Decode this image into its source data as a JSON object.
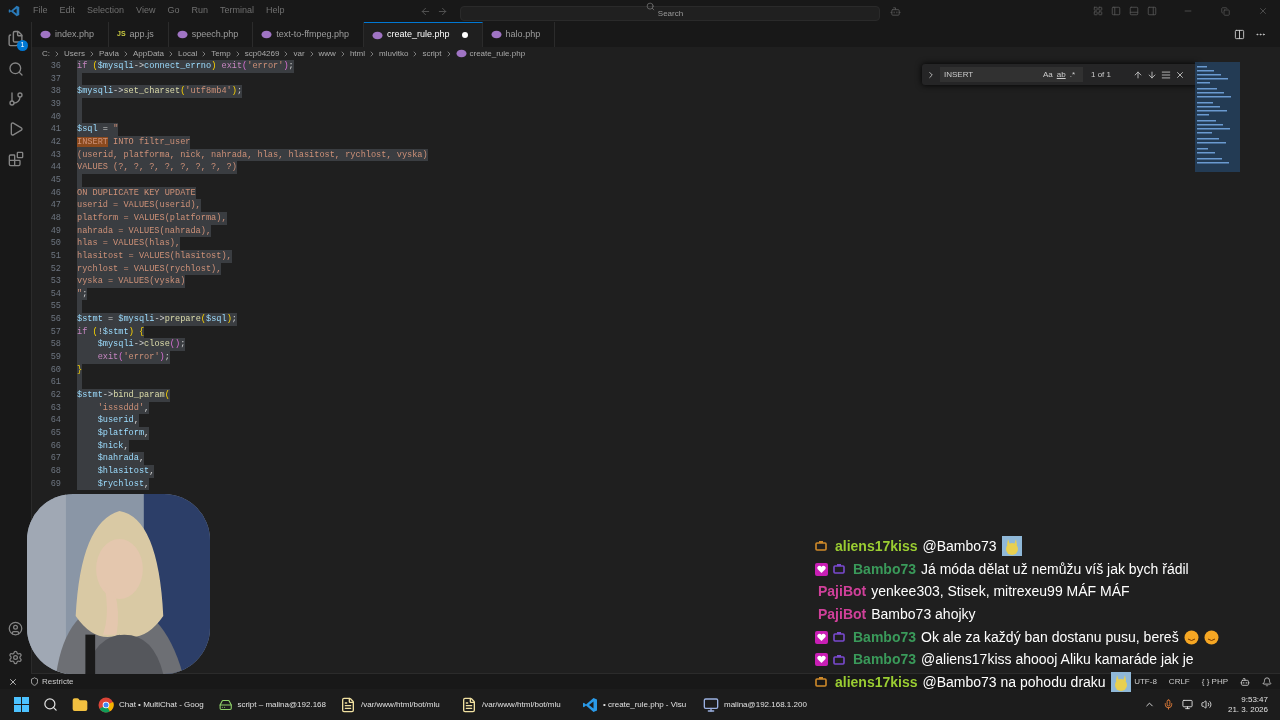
{
  "menu": [
    "File",
    "Edit",
    "Selection",
    "View",
    "Go",
    "Run",
    "Terminal",
    "Help"
  ],
  "search": {
    "placeholder": "Search"
  },
  "tabs": [
    {
      "label": "index.php",
      "kind": "php",
      "selected": false,
      "modified": false
    },
    {
      "label": "app.js",
      "kind": "js",
      "icon_text": "JS",
      "selected": false,
      "modified": false
    },
    {
      "label": "speech.php",
      "kind": "php",
      "selected": false,
      "modified": false
    },
    {
      "label": "text-to-ffmpeg.php",
      "kind": "php",
      "selected": false,
      "modified": false
    },
    {
      "label": "create_rule.php",
      "kind": "php",
      "selected": true,
      "modified": true
    },
    {
      "label": "halo.php",
      "kind": "php",
      "selected": false,
      "modified": false
    }
  ],
  "explorer_badge": "1",
  "breadcrumbs": [
    "C:",
    "Users",
    "Pavla",
    "AppData",
    "Local",
    "Temp",
    "scp04269",
    "var",
    "www",
    "html",
    "mluvitko",
    "script",
    "create_rule.php"
  ],
  "find": {
    "value": "INSERT",
    "options": [
      "Aa",
      "ab",
      ".*"
    ],
    "result": "1 of 1"
  },
  "editor": {
    "lines": [
      {
        "number": "36",
        "selected": true,
        "segs": [
          {
            "kind": "kw",
            "text": "if"
          },
          {
            "kind": "brace",
            "text": " ("
          },
          {
            "kind": "var",
            "text": "$mysqli"
          },
          {
            "kind": "plain",
            "text": "->"
          },
          {
            "kind": "var",
            "text": "connect_errno"
          },
          {
            "kind": "brace",
            "text": ") "
          },
          {
            "kind": "kw",
            "text": "exit"
          },
          {
            "kind": "paren",
            "text": "("
          },
          {
            "kind": "str",
            "text": "'error'"
          },
          {
            "kind": "paren",
            "text": ")"
          },
          {
            "kind": "plain",
            "text": ";"
          }
        ]
      },
      {
        "number": "37",
        "selected": true
      },
      {
        "number": "38",
        "selected": true,
        "segs": [
          {
            "kind": "var",
            "text": "$mysqli"
          },
          {
            "kind": "plain",
            "text": "->"
          },
          {
            "kind": "fn",
            "text": "set_charset"
          },
          {
            "kind": "brace",
            "text": "("
          },
          {
            "kind": "str",
            "text": "'utf8mb4'"
          },
          {
            "kind": "brace",
            "text": ")"
          },
          {
            "kind": "plain",
            "text": ";"
          }
        ]
      },
      {
        "number": "39",
        "selected": true
      },
      {
        "number": "40",
        "selected": true
      },
      {
        "number": "41",
        "selected": true,
        "segs": [
          {
            "kind": "var",
            "text": "$sql"
          },
          {
            "kind": "plain",
            "text": " = "
          },
          {
            "kind": "str",
            "text": "\""
          }
        ]
      },
      {
        "number": "42",
        "selected": true,
        "segs": [
          {
            "kind": "match",
            "text": "INSERT"
          },
          {
            "kind": "str",
            "text": " INTO filtr_user"
          }
        ]
      },
      {
        "number": "43",
        "selected": true,
        "segs": [
          {
            "kind": "str",
            "text": "(userid, platforma, nick, nahrada, hlas, hlasitost, rychlost, vyska)"
          }
        ]
      },
      {
        "number": "44",
        "selected": true,
        "segs": [
          {
            "kind": "str",
            "text": "VALUES (?, ?, ?, ?, ?, ?, ?, ?)"
          }
        ]
      },
      {
        "number": "45",
        "selected": true
      },
      {
        "number": "46",
        "selected": true,
        "segs": [
          {
            "kind": "str",
            "text": "ON DUPLICATE KEY UPDATE"
          }
        ]
      },
      {
        "number": "47",
        "selected": true,
        "segs": [
          {
            "kind": "str",
            "text": "userid = VALUES(userid),"
          }
        ]
      },
      {
        "number": "48",
        "selected": true,
        "segs": [
          {
            "kind": "str",
            "text": "platform = VALUES(platforma),"
          }
        ]
      },
      {
        "number": "49",
        "selected": true,
        "segs": [
          {
            "kind": "str",
            "text": "nahrada = VALUES(nahrada),"
          }
        ]
      },
      {
        "number": "50",
        "selected": true,
        "segs": [
          {
            "kind": "str",
            "text": "hlas = VALUES(hlas),"
          }
        ]
      },
      {
        "number": "51",
        "selected": true,
        "segs": [
          {
            "kind": "str",
            "text": "hlasitost = VALUES(hlasitost),"
          }
        ]
      },
      {
        "number": "52",
        "selected": true,
        "segs": [
          {
            "kind": "str",
            "text": "rychlost = VALUES(rychlost),"
          }
        ]
      },
      {
        "number": "53",
        "selected": true,
        "segs": [
          {
            "kind": "str",
            "text": "vyska = VALUES(vyska)"
          }
        ]
      },
      {
        "number": "54",
        "selected": true,
        "segs": [
          {
            "kind": "str",
            "text": "\""
          },
          {
            "kind": "plain",
            "text": ";"
          }
        ]
      },
      {
        "number": "55",
        "selected": true
      },
      {
        "number": "56",
        "selected": true,
        "segs": [
          {
            "kind": "var",
            "text": "$stmt"
          },
          {
            "kind": "plain",
            "text": " = "
          },
          {
            "kind": "var",
            "text": "$mysqli"
          },
          {
            "kind": "plain",
            "text": "->"
          },
          {
            "kind": "fn",
            "text": "prepare"
          },
          {
            "kind": "brace",
            "text": "("
          },
          {
            "kind": "var",
            "text": "$sql"
          },
          {
            "kind": "brace",
            "text": ")"
          },
          {
            "kind": "plain",
            "text": ";"
          }
        ]
      },
      {
        "number": "57",
        "selected": true,
        "segs": [
          {
            "kind": "kw",
            "text": "if"
          },
          {
            "kind": "brace",
            "text": " ("
          },
          {
            "kind": "plain",
            "text": "!"
          },
          {
            "kind": "var",
            "text": "$stmt"
          },
          {
            "kind": "brace",
            "text": ") {"
          }
        ]
      },
      {
        "number": "58",
        "selected": true,
        "segs": [
          {
            "kind": "var",
            "text": "    $mysqli"
          },
          {
            "kind": "plain",
            "text": "->"
          },
          {
            "kind": "fn",
            "text": "close"
          },
          {
            "kind": "paren",
            "text": "()"
          },
          {
            "kind": "plain",
            "text": ";"
          }
        ]
      },
      {
        "number": "59",
        "selected": true,
        "segs": [
          {
            "kind": "kw",
            "text": "    exit"
          },
          {
            "kind": "paren",
            "text": "("
          },
          {
            "kind": "str",
            "text": "'error'"
          },
          {
            "kind": "paren",
            "text": ")"
          },
          {
            "kind": "plain",
            "text": ";"
          }
        ]
      },
      {
        "number": "60",
        "selected": true,
        "segs": [
          {
            "kind": "brace",
            "text": "}"
          }
        ]
      },
      {
        "number": "61",
        "selected": true
      },
      {
        "number": "62",
        "selected": true,
        "segs": [
          {
            "kind": "var",
            "text": "$stmt"
          },
          {
            "kind": "plain",
            "text": "->"
          },
          {
            "kind": "fn",
            "text": "bind_param"
          },
          {
            "kind": "brace",
            "text": "("
          }
        ]
      },
      {
        "number": "63",
        "selected": true,
        "segs": [
          {
            "kind": "str",
            "text": "    'isssddd'"
          },
          {
            "kind": "plain",
            "text": ","
          }
        ]
      },
      {
        "number": "64",
        "selected": true,
        "segs": [
          {
            "kind": "var",
            "text": "    $userid"
          },
          {
            "kind": "plain",
            "text": ","
          }
        ]
      },
      {
        "number": "65",
        "selected": true,
        "segs": [
          {
            "kind": "var",
            "text": "    $platform"
          },
          {
            "kind": "plain",
            "text": ","
          }
        ]
      },
      {
        "number": "66",
        "selected": true,
        "segs": [
          {
            "kind": "var",
            "text": "    $nick"
          },
          {
            "kind": "plain",
            "text": ","
          }
        ]
      },
      {
        "number": "67",
        "selected": true,
        "segs": [
          {
            "kind": "var",
            "text": "    $nahrada"
          },
          {
            "kind": "plain",
            "text": ","
          }
        ]
      },
      {
        "number": "68",
        "selected": true,
        "segs": [
          {
            "kind": "var",
            "text": "    $hlasitost"
          },
          {
            "kind": "plain",
            "text": ","
          }
        ]
      },
      {
        "number": "69",
        "selected": true,
        "segs": [
          {
            "kind": "var",
            "text": "    $rychlost"
          },
          {
            "kind": "plain",
            "text": ","
          }
        ]
      }
    ]
  },
  "webcam": {
    "kind": "picture"
  },
  "chat": [
    {
      "user": "aliens17kiss",
      "color": "#9acd32",
      "badges": [
        {
          "kind": "bits"
        }
      ],
      "text": "@Bambo73",
      "emotes": [
        {
          "kind": "emote"
        }
      ]
    },
    {
      "user": "Bambo73",
      "color": "#3a9a5a",
      "badges": [
        {
          "kind": "heart"
        },
        {
          "kind": "sub"
        }
      ],
      "text": "Já móda dělat už nemůžu víš jak bych řádil"
    },
    {
      "user": "PajiBot",
      "color": "#d0409a",
      "text": "yenkee303, Stisek, mitrexeu99 MÁF MÁF"
    },
    {
      "user": "PajiBot",
      "color": "#d0409a",
      "text": "Bambo73 ahojky"
    },
    {
      "user": "Bambo73",
      "color": "#3a9a5a",
      "badges": [
        {
          "kind": "heart"
        },
        {
          "kind": "sub"
        }
      ],
      "text": "Ok ale za každý ban dostanu pusu, bereš",
      "emotes": [
        {
          "kind": "emoji"
        },
        {
          "kind": "emoji"
        }
      ]
    },
    {
      "user": "Bambo73",
      "color": "#3a9a5a",
      "badges": [
        {
          "kind": "heart"
        },
        {
          "kind": "sub"
        }
      ],
      "text": "@aliens17kiss ahoooj Aliku kamaráde jak je"
    },
    {
      "user": "aliens17kiss",
      "color": "#9acd32",
      "badges": [
        {
          "kind": "bits"
        }
      ],
      "text": "@Bambo73 na pohodu draku",
      "emotes": [
        {
          "kind": "emote"
        }
      ]
    }
  ],
  "status_bar": {
    "mode": "Restricte",
    "right": [
      "UTF-8",
      "CRLF",
      "{ } PHP"
    ]
  },
  "taskbar": [
    {
      "label": "Chat • MultiChat - Goog",
      "kind": "chrome"
    },
    {
      "label": "script – malina@192.168",
      "kind": "winscp"
    },
    {
      "label": "/var/www/html/bot/mlu",
      "kind": "notepad"
    },
    {
      "label": "/var/www/html/bot/mlu",
      "kind": "notepad"
    },
    {
      "label": "• create_rule.php - Visu",
      "kind": "vscode"
    },
    {
      "label": "malina@192.168.1.200",
      "kind": "putty"
    }
  ],
  "clock": {
    "time": "9:53:47",
    "date": "21. 3. 2026"
  }
}
